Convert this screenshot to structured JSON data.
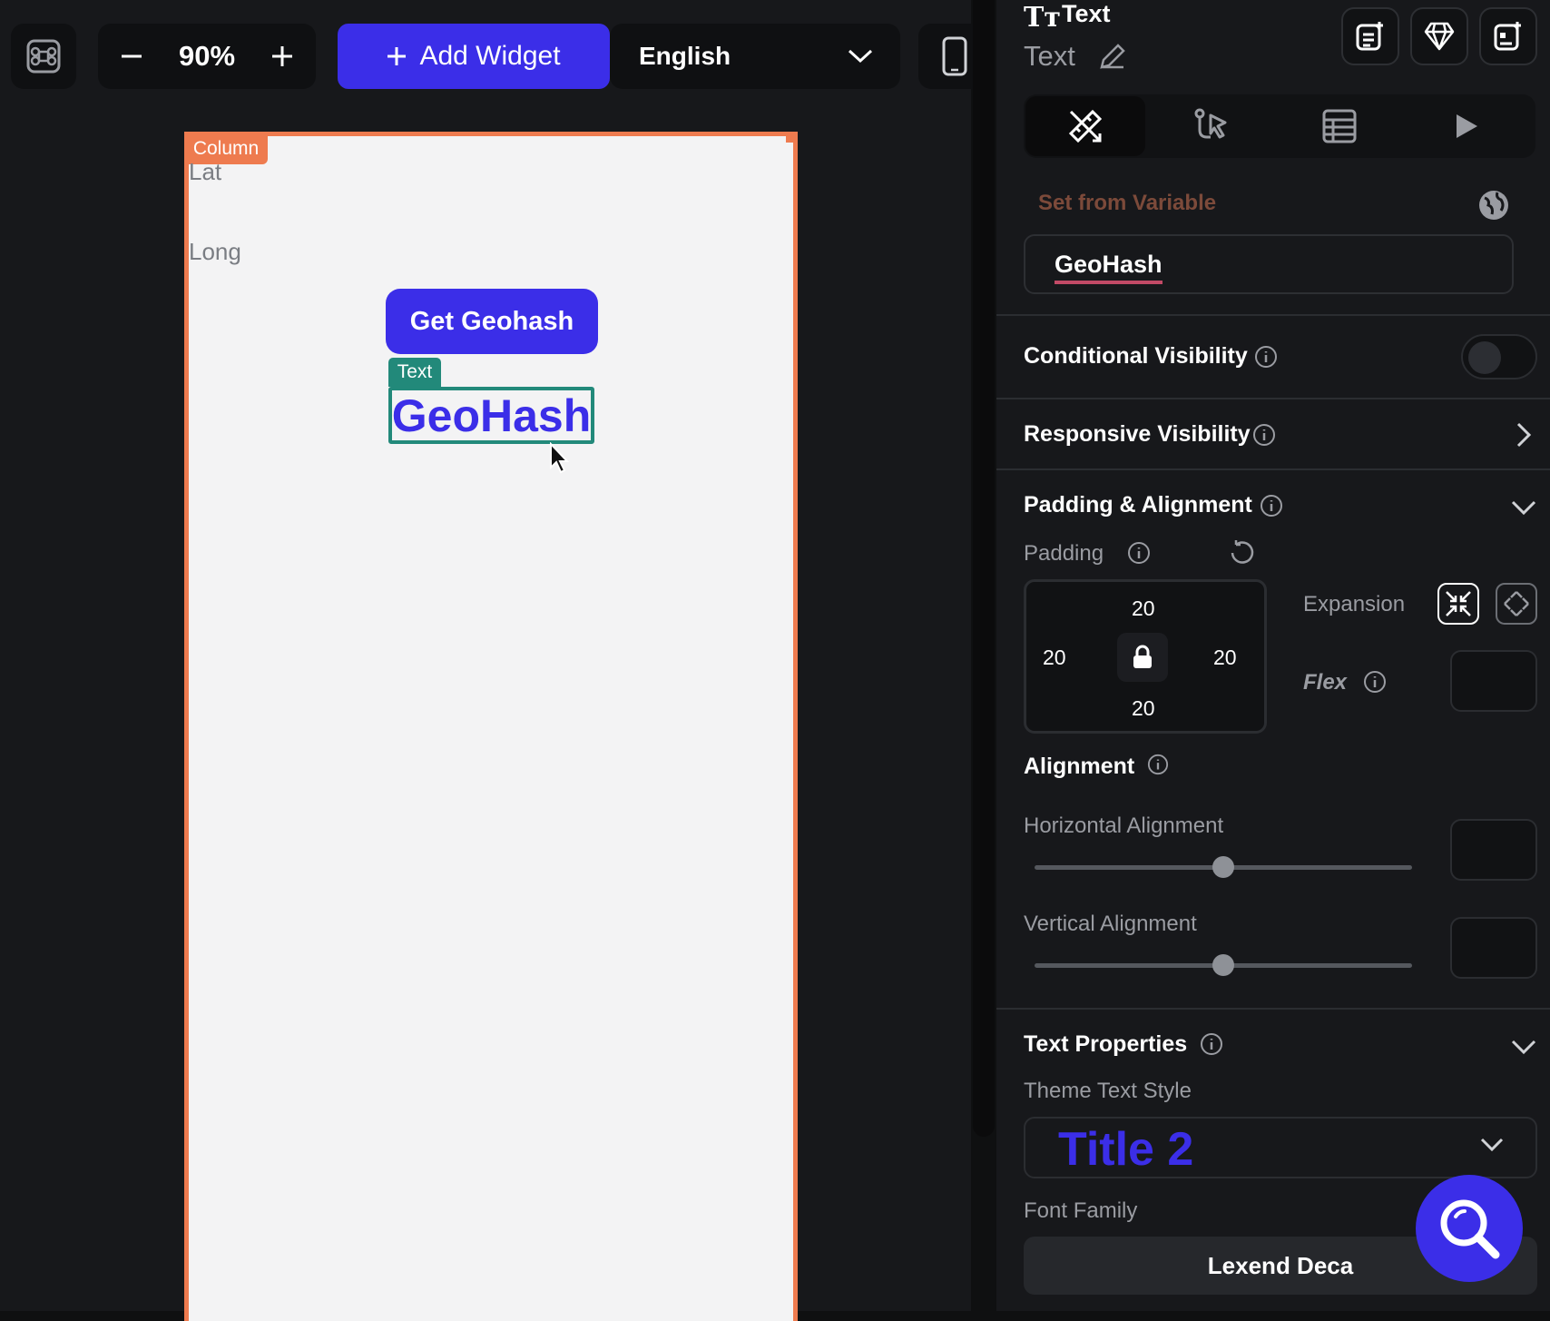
{
  "toolbar": {
    "zoom_value": "90%",
    "add_widget_label": "Add Widget",
    "language": "English",
    "zoom_out_icon": "minus-icon",
    "zoom_in_icon": "plus-icon",
    "shortcuts_icon": "command-key-icon",
    "device_icon": "phone-icon"
  },
  "canvas": {
    "column_tag": "Column",
    "lat_label": "Lat",
    "long_label": "Long",
    "button_label": "Get Geohash",
    "text_tag": "Text",
    "text_value": "GeoHash"
  },
  "panel": {
    "title": "Text",
    "widget_name": "Text",
    "set_from_variable": "Set from Variable",
    "variable_value": "GeoHash",
    "conditional_visibility": "Conditional Visibility",
    "conditional_visibility_on": false,
    "responsive_visibility": "Responsive Visibility",
    "padding_alignment": "Padding & Alignment",
    "padding_label": "Padding",
    "padding": {
      "top": "20",
      "left": "20",
      "right": "20",
      "bottom": "20"
    },
    "expansion_label": "Expansion",
    "flex_label": "Flex",
    "alignment_label": "Alignment",
    "horizontal_alignment": "Horizontal Alignment",
    "horizontal_alignment_value": 0.5,
    "vertical_alignment": "Vertical Alignment",
    "vertical_alignment_value": 0.5,
    "text_properties": "Text Properties",
    "theme_text_style_label": "Theme Text Style",
    "theme_text_style_value": "Title 2",
    "font_family_label": "Font Family",
    "font_family_value": "Lexend Deca"
  },
  "colors": {
    "accent": "#3b2ee8",
    "column_outline": "#ee7b4f",
    "text_selection": "#22897a",
    "variable_underline": "#c24a66"
  }
}
